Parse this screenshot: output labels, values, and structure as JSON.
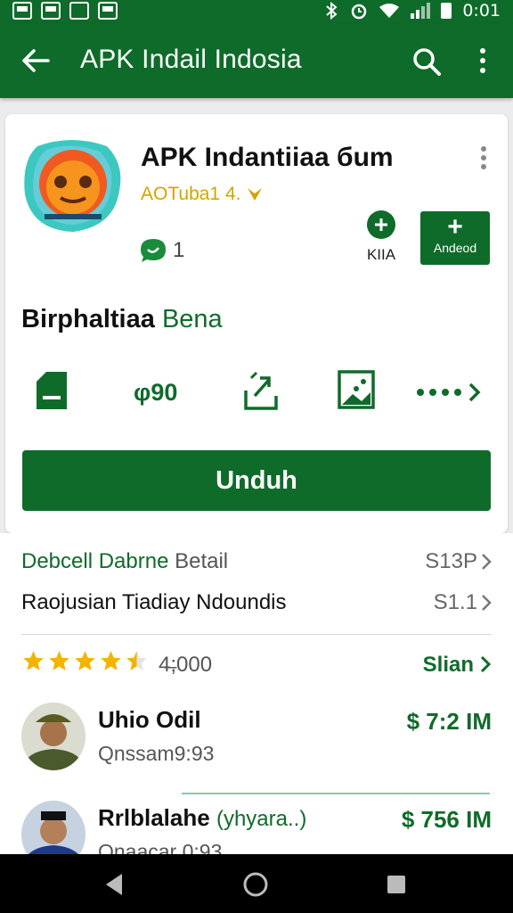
{
  "status_bar": {
    "time": "0:01"
  },
  "app_bar": {
    "title": "APK Indail Indosia"
  },
  "app": {
    "name": "APK Indantiiaa бum",
    "developer": "AOTuba1 4.",
    "review_count": "1",
    "wishlist_label": "KIIA",
    "add_label": "Andeod",
    "subtitle_part1": "Birphaltiaa",
    "subtitle_part2": "Bena",
    "price": "φ90",
    "install_label": "Unduh"
  },
  "details": {
    "row1": {
      "label_a": "Debcell Dabrne",
      "label_b": "Betail",
      "value": "S13P"
    },
    "row2": {
      "label": "Raojusian Tiadiay Ndoundis",
      "value": "S1.1"
    },
    "rating": {
      "stars": 4.5,
      "count": "4̶;000",
      "see_all": "Slian"
    }
  },
  "reviews": [
    {
      "name": "Uhio Odil",
      "tag": "",
      "handle": "Qnssam9:93",
      "amount": "$ 7:2 IM"
    },
    {
      "name": "Rrlblalahe",
      "tag": "(yhyara..)",
      "handle": "Qnaacar 0:93",
      "amount": "$ 756 IM"
    }
  ],
  "colors": {
    "primary": "#0f6b2a",
    "star": "#f2b400",
    "developer": "#d4a400"
  }
}
